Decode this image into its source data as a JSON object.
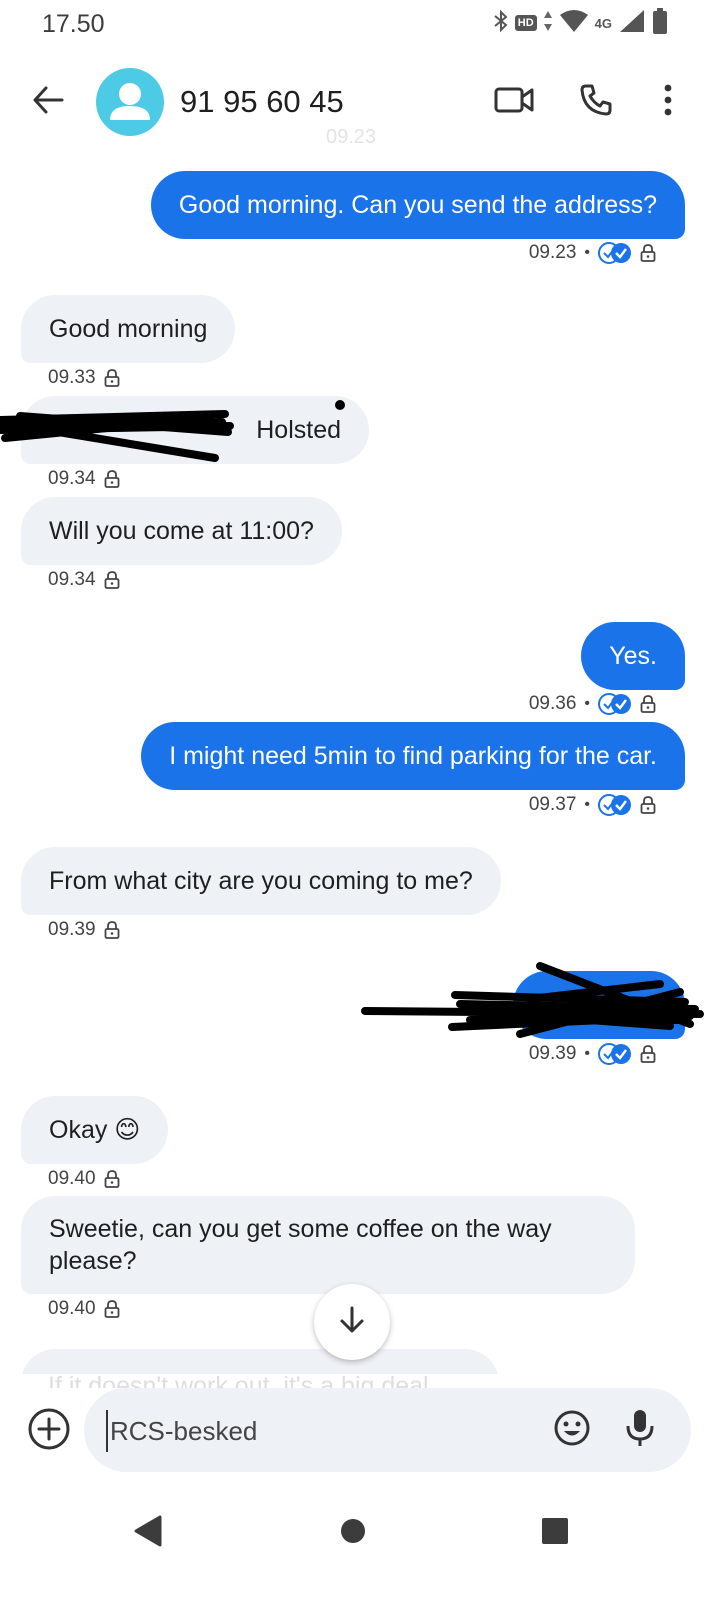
{
  "status_bar": {
    "time": "17.50",
    "hd_label": "HD",
    "network_label": "4G",
    "icons": [
      "bluetooth-icon",
      "hd-icon",
      "data-arrows-icon",
      "wifi-icon",
      "signal-icon",
      "battery-icon"
    ]
  },
  "header": {
    "contact": "91 95 60 45",
    "faint_time": "09.23",
    "buttons": [
      "back-arrow-icon",
      "video-call-icon",
      "phone-icon",
      "more-vert-icon"
    ]
  },
  "colors": {
    "outgoing_bubble": "#1a73e8",
    "incoming_bubble": "#eef1f6",
    "avatar": "#4dcbe6",
    "read_receipt": "#1a73e8"
  },
  "messages": [
    {
      "dir": "out",
      "text": "Good morning. Can you send the address?",
      "time": "09.23",
      "read": true
    },
    {
      "dir": "in",
      "text": "Good morning",
      "time": "09.33"
    },
    {
      "dir": "in",
      "text": "Holsted",
      "time": "09.34",
      "redacted": true
    },
    {
      "dir": "in",
      "text": "Will you come at 11:00?",
      "time": "09.34"
    },
    {
      "dir": "out",
      "text": "Yes.",
      "time": "09.36",
      "read": true
    },
    {
      "dir": "out",
      "text": "I might need 5min to find parking for the car.",
      "time": "09.37",
      "read": true
    },
    {
      "dir": "in",
      "text": "From what city are you coming to me?",
      "time": "09.39"
    },
    {
      "dir": "out",
      "text": "",
      "time": "09.39",
      "read": true,
      "redacted": true
    },
    {
      "dir": "in",
      "text": "Okay 😊",
      "time": "09.40"
    },
    {
      "dir": "in",
      "text": "Sweetie, can you get some coffee on the way please?",
      "time": "09.40"
    }
  ],
  "peek_message": "If it doesn't work out, it's a big deal",
  "compose": {
    "placeholder": "RCS-besked",
    "buttons": [
      "add-icon",
      "emoji-icon",
      "mic-icon"
    ]
  },
  "nav": [
    "back-triangle-icon",
    "home-circle-icon",
    "recents-square-icon"
  ]
}
